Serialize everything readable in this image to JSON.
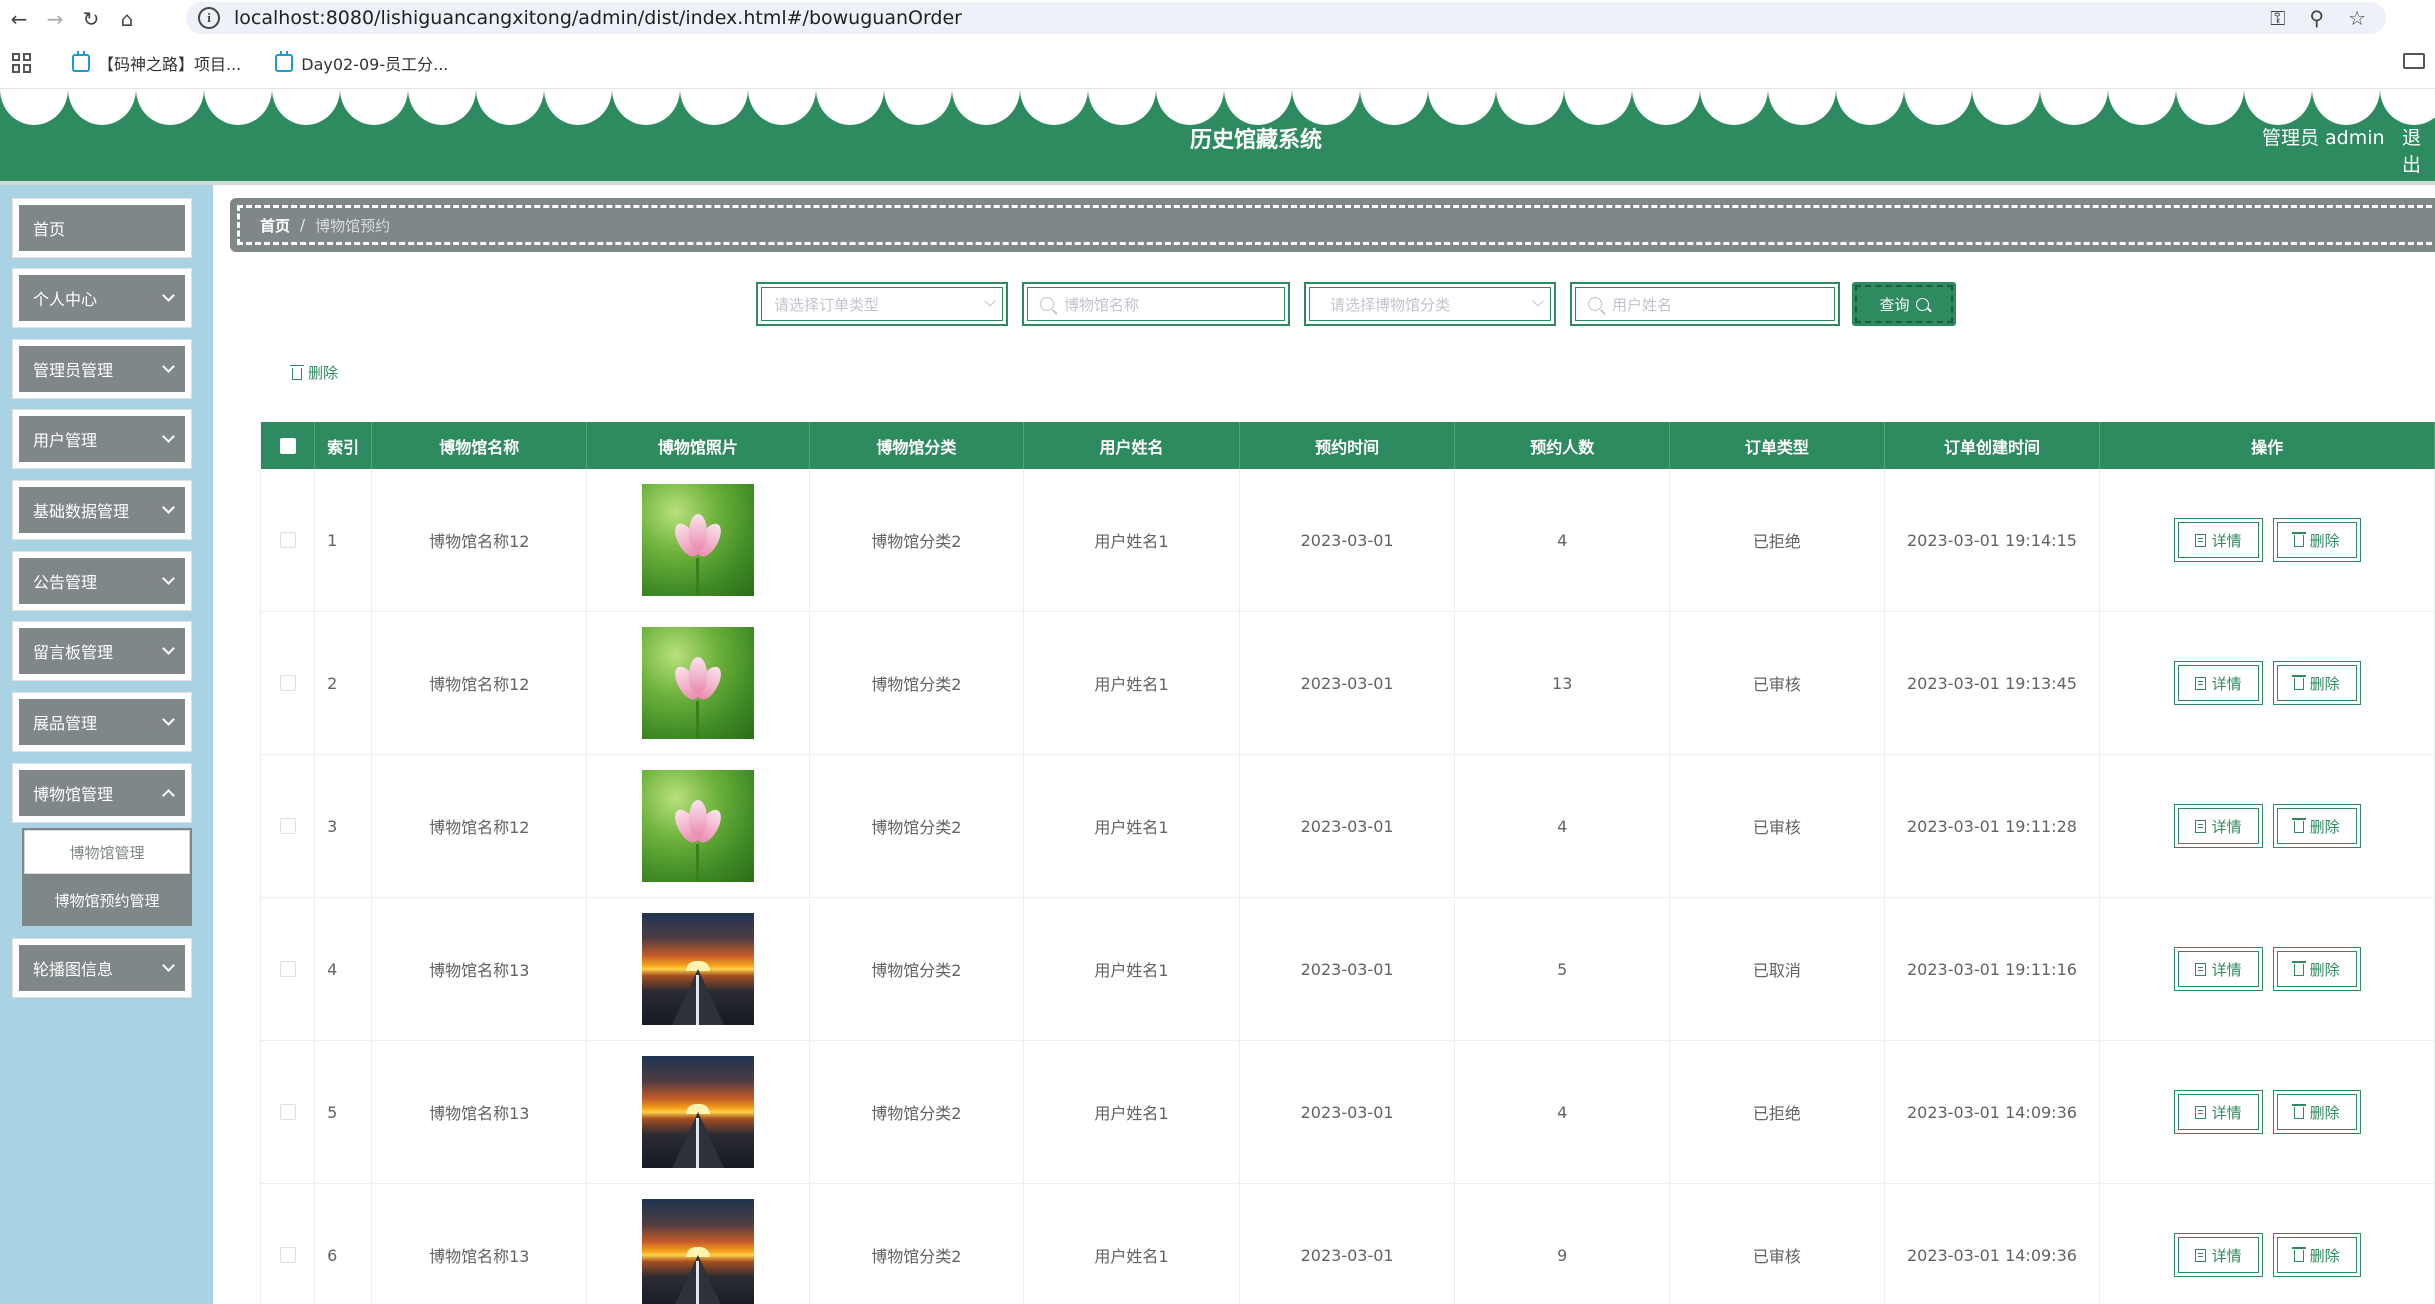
{
  "browser": {
    "url": "localhost:8080/lishiguancangxitong/admin/dist/index.html#/bowuguanOrder",
    "bookmarks": [
      "【码神之路】项目...",
      "Day02-09-员工分..."
    ]
  },
  "header": {
    "title": "历史馆藏系统",
    "admin": "管理员 admin",
    "logout": "退出"
  },
  "sidebar": {
    "items": [
      {
        "label": "首页"
      },
      {
        "label": "个人中心"
      },
      {
        "label": "管理员管理"
      },
      {
        "label": "用户管理"
      },
      {
        "label": "基础数据管理"
      },
      {
        "label": "公告管理"
      },
      {
        "label": "留言板管理"
      },
      {
        "label": "展品管理"
      },
      {
        "label": "博物馆管理"
      },
      {
        "label": "轮播图信息"
      }
    ],
    "submenu": [
      "博物馆管理",
      "博物馆预约管理"
    ]
  },
  "breadcrumb": {
    "home": "首页",
    "sep": "/",
    "current": "博物馆预约"
  },
  "search": {
    "order_type_placeholder": "请选择订单类型",
    "museum_name_placeholder": "博物馆名称",
    "category_placeholder": "请选择博物馆分类",
    "user_name_placeholder": "用户姓名",
    "query_label": "查询"
  },
  "toolbar": {
    "delete_label": "删除"
  },
  "table": {
    "headers": [
      "索引",
      "博物馆名称",
      "博物馆照片",
      "博物馆分类",
      "用户姓名",
      "预约时间",
      "预约人数",
      "订单类型",
      "订单创建时间",
      "操作"
    ],
    "rows": [
      {
        "index": "1",
        "name": "博物馆名称12",
        "photo": "lotus",
        "category": "博物馆分类2",
        "user": "用户姓名1",
        "date": "2023-03-01",
        "count": "4",
        "type": "已拒绝",
        "created": "2023-03-01 19:14:15"
      },
      {
        "index": "2",
        "name": "博物馆名称12",
        "photo": "lotus",
        "category": "博物馆分类2",
        "user": "用户姓名1",
        "date": "2023-03-01",
        "count": "13",
        "type": "已审核",
        "created": "2023-03-01 19:13:45"
      },
      {
        "index": "3",
        "name": "博物馆名称12",
        "photo": "lotus",
        "category": "博物馆分类2",
        "user": "用户姓名1",
        "date": "2023-03-01",
        "count": "4",
        "type": "已审核",
        "created": "2023-03-01 19:11:28"
      },
      {
        "index": "4",
        "name": "博物馆名称13",
        "photo": "sunset",
        "category": "博物馆分类2",
        "user": "用户姓名1",
        "date": "2023-03-01",
        "count": "5",
        "type": "已取消",
        "created": "2023-03-01 19:11:16"
      },
      {
        "index": "5",
        "name": "博物馆名称13",
        "photo": "sunset",
        "category": "博物馆分类2",
        "user": "用户姓名1",
        "date": "2023-03-01",
        "count": "4",
        "type": "已拒绝",
        "created": "2023-03-01 14:09:36"
      },
      {
        "index": "6",
        "name": "博物馆名称13",
        "photo": "sunset",
        "category": "博物馆分类2",
        "user": "用户姓名1",
        "date": "2023-03-01",
        "count": "9",
        "type": "已审核",
        "created": "2023-03-01 14:09:36"
      }
    ],
    "actions": {
      "detail": "详情",
      "delete": "删除"
    }
  },
  "colors": {
    "theme_green": "#2e8b5f",
    "sidebar_bg": "#a9d3e3",
    "menu_gray": "#7f8789"
  }
}
